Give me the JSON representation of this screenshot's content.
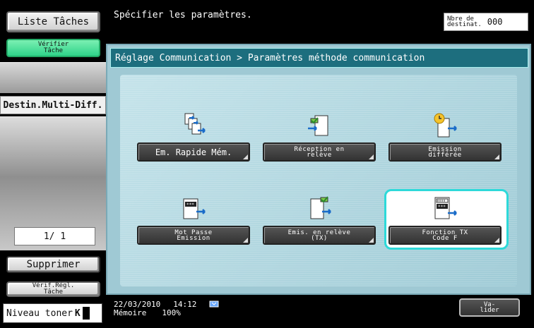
{
  "left_panel": {
    "liste_taches": "Liste Tâches",
    "verifier_tache_line1": "Vérifier",
    "verifier_tache_line2": "Tâche",
    "destin_multi_diff": "Destin.Multi-Diff.",
    "page_indicator": "1/ 1",
    "supprimer": "Supprimer",
    "verif_regl_line1": "Vérif.Régl.",
    "verif_regl_line2": "Tâche",
    "niveau_toner": "Niveau toner",
    "toner_color": "K"
  },
  "header": {
    "message": "Spécifier les paramètres.",
    "dest_label_line1": "Nbre de",
    "dest_label_line2": "destinat.",
    "dest_count": "000"
  },
  "main": {
    "breadcrumb": "Réglage Communication > Paramètres méthode communication",
    "functions": [
      {
        "big": "Em. Rapide Mém.",
        "icon": "quick-memory-tx-icon"
      },
      {
        "line1": "Réception en",
        "line2": "relève",
        "icon": "polling-rx-icon"
      },
      {
        "line1": "Emission",
        "line2": "différée",
        "icon": "timer-tx-icon"
      },
      {
        "line1": "Mot Passe",
        "line2": "Emission",
        "icon": "password-tx-icon"
      },
      {
        "line1": "Emis. en relève",
        "line2": "(TX)",
        "icon": "polling-tx-icon"
      },
      {
        "line1": "Fonction TX",
        "line2": "Code F",
        "icon": "f-code-tx-icon"
      }
    ],
    "selected_function": "Fonction TX Code F"
  },
  "footer": {
    "date": "22/03/2010",
    "time": "14:12",
    "memory_label": "Mémoire",
    "memory_value": "100%",
    "valider_line1": "Va-",
    "valider_line2": "lider"
  },
  "colors": {
    "panel_bg": "#9fc9d4",
    "breadcrumb_bg": "#1d6e7e",
    "highlight": "#2dd9d9",
    "active_green": "#2fd28a"
  }
}
